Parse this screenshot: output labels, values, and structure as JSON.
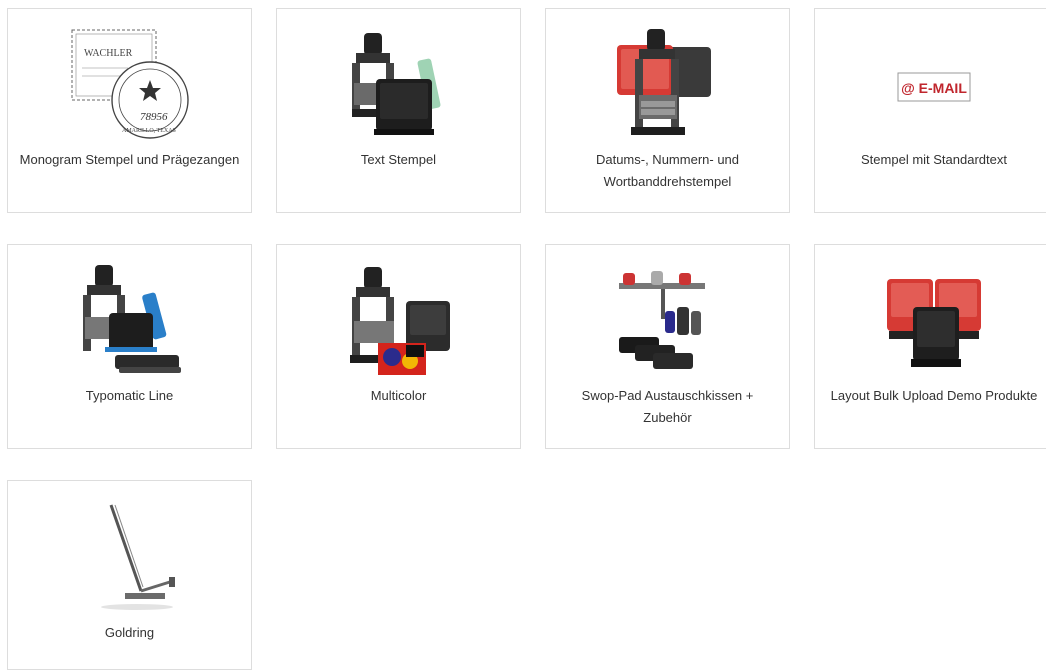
{
  "categories": [
    {
      "label": "Monogram Stempel und Prägezangen",
      "icon": "monogram-stamp-icon",
      "image_text": [
        "WACHLER",
        "78956",
        "AMARILLO, TEXAS"
      ]
    },
    {
      "label": "Text Stempel",
      "icon": "text-stamp-icon"
    },
    {
      "label": "Datums-, Nummern- und Wortbanddrehstempel",
      "icon": "date-number-stamp-icon"
    },
    {
      "label": "Stempel mit Standardtext",
      "icon": "email-stamp-icon",
      "image_text": [
        "@ E-MAIL"
      ]
    },
    {
      "label": "Typomatic Line",
      "icon": "typomatic-stamp-icon"
    },
    {
      "label": "Multicolor",
      "icon": "multicolor-stamp-icon"
    },
    {
      "label": "Swop-Pad Austauschkissen + Zubehör",
      "icon": "swop-pad-icon"
    },
    {
      "label": "Layout Bulk Upload Demo Produkte",
      "icon": "bulk-upload-stamp-icon"
    },
    {
      "label": "Goldring",
      "icon": "goldring-stamp-icon"
    }
  ],
  "colors": {
    "card_border": "#dddddd",
    "label_text": "#333333",
    "stamp_dark": "#222222",
    "stamp_red": "#d63a34",
    "stamp_blue": "#2a7fc9",
    "email_red": "#c0262d"
  }
}
